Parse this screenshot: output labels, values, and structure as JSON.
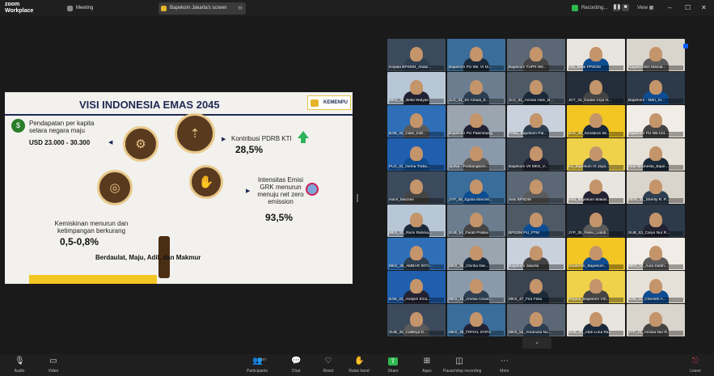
{
  "app": {
    "logo_line1": "zoom",
    "logo_line2": "Workplace"
  },
  "tabs": [
    {
      "label": "Meeting",
      "icon": "paw-icon"
    },
    {
      "label": "Bapekom Jakarta's screen",
      "icon": "screen-share-icon"
    }
  ],
  "recording": {
    "label": "Recording...",
    "pause": "❚❚",
    "stop": "■"
  },
  "view_label": "View",
  "slide": {
    "title": "VISI INDONESIA EMAS 2045",
    "logo": "KEMENPU",
    "income_label": "Pendapatan per kapita setara negara maju",
    "income_value": "USD 23.000 - 30.300",
    "pdrb_label": "Kontribusi PDRB KTI",
    "pdrb_value": "28,5%",
    "emission_label": "Intensitas Emisi GRK menurun menuju net zero emission",
    "emission_value": "93,5%",
    "poverty_label": "Kemiskinan menurun dan ketimpangan berkurang",
    "poverty_value": "0,5-0,8%",
    "motto": "Berdaulat, Maju, Adil, dan Makmur"
  },
  "gallery": {
    "tiles": [
      "Kepala BPSDM_Abdul...",
      "Bapekom PU Wil. VI M...",
      "Bapekom TUPR Wil...",
      "Ciki_Balai PPSDM",
      "Nagakombis Manuk...",
      "MKS_30_Bella Widyan",
      "JLG_31_Eri Afriadi_E...",
      "JLG_31_Annisa Hani_B...",
      "JKT_33_Dudan Arya H...",
      "Bapekom - Mdn_Sr...",
      "BJM_43_Calin_Indr...",
      "Bapekom PU Palembang",
      "Pelita_Bapekom Pal...",
      "JLG_39_Sondarus Sk...",
      "Bapekom PU Wil.Cet...",
      "PLG_31_Gema Traba...",
      "Sjofva - Pusbangkom...",
      "Bapekom VII MKS_V...",
      "Ka_Bapekom IX Jaya...",
      "Akar Bramesta_Bape...",
      "Hanif_Marzuki",
      "JYP_48_Egidia Marcell...",
      "Sesi BPSDM",
      "Isha_Bapekom Makas...",
      "MDN_31_Sherlly R. P...",
      "MKS_51_Rumi Rahma...",
      "SUB_54_Farah Pratiwi",
      "BPSDM PU_PTM",
      "JYP_35_Feteu_Latuh...",
      "SUB_53_Caryo Nur R...",
      "MKS_35_AMBAR INTA...",
      "MKS_35_Chintia Dwi...",
      "Bapekom Jakarta",
      "SarahAlib_Bapekom...",
      "MKS_10_Aura Safitri...",
      "BJM_23_Andykh Ezra...",
      "MKS_16_Amelia Azwar...",
      "MKS_47_Fira Felia",
      "Regina_Bapekom VIII...",
      "BJM_41_Cherieth A...",
      "SUB_38_Cattleya D...",
      "MKS_48_FIRYAL SYIFA",
      "MKS_54_Amanusa Nu...",
      "SUB_05_Abdi Luna Ra...",
      "JYP_21_Annisa Nur R..."
    ]
  },
  "toolbar": {
    "items": [
      {
        "label": "Audio",
        "icon": "microphone-muted-icon"
      },
      {
        "label": "Video",
        "icon": "video-camera-icon"
      },
      {
        "label": "Participants",
        "icon": "participants-icon",
        "count": "297"
      },
      {
        "label": "Chat",
        "icon": "chat-icon"
      },
      {
        "label": "React",
        "icon": "heart-icon"
      },
      {
        "label": "Raise hand",
        "icon": "hand-icon"
      },
      {
        "label": "Share",
        "icon": "share-screen-icon"
      },
      {
        "label": "Apps",
        "icon": "apps-icon"
      },
      {
        "label": "Pause/stop recording",
        "icon": "recording-control-icon"
      },
      {
        "label": "More",
        "icon": "more-icon"
      },
      {
        "label": "Leave",
        "icon": "leave-icon"
      }
    ]
  },
  "colors": {
    "accent": "#0b5cff",
    "share": "#2eb84f",
    "leave": "#e0384a",
    "slide_navy": "#1e2a52",
    "slide_yellow": "#f3c623"
  }
}
